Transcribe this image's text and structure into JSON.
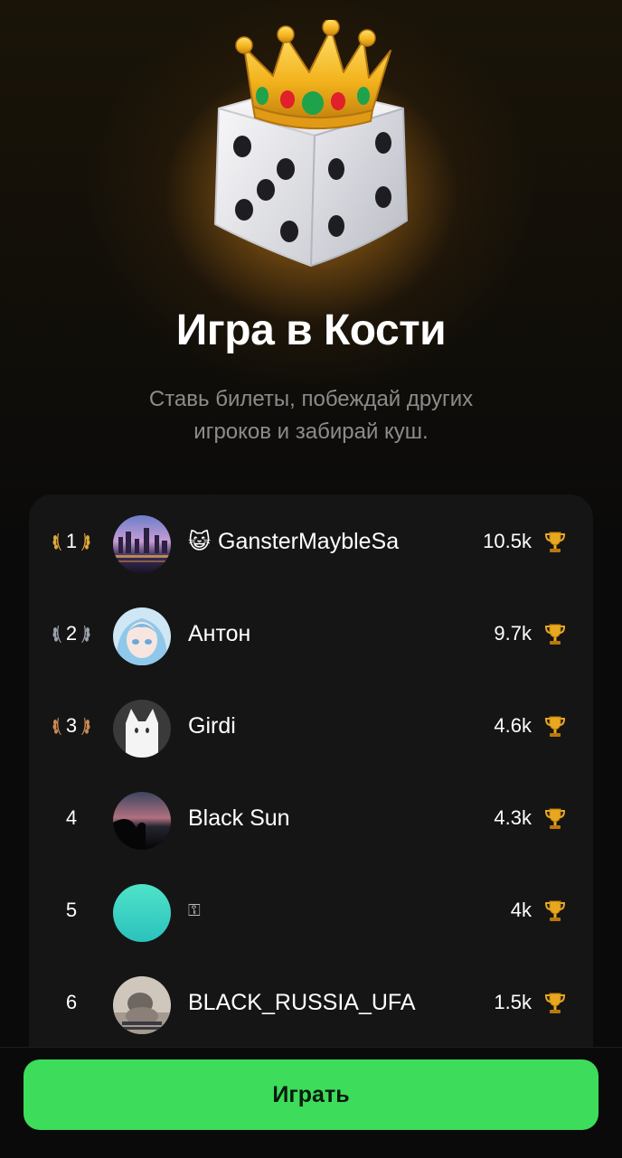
{
  "title": "Игра в Кости",
  "subtitle_line1": "Ставь билеты, побеждай других",
  "subtitle_line2": "игроков и забирай куш.",
  "leaderboard": [
    {
      "rank": "1",
      "emoji": "😺",
      "name": "GansterMaybleSa",
      "score": "10.5k",
      "laurel_color": "#e0a93a",
      "avatar": "city-night"
    },
    {
      "rank": "2",
      "emoji": "",
      "name": "Антон",
      "score": "9.7k",
      "laurel_color": "#9aa3ad",
      "avatar": "anime-girl"
    },
    {
      "rank": "3",
      "emoji": "",
      "name": "Girdi",
      "score": "4.6k",
      "laurel_color": "#c98a52",
      "avatar": "white-cat"
    },
    {
      "rank": "4",
      "emoji": "",
      "name": "Black Sun",
      "score": "4.3k",
      "laurel_color": "",
      "avatar": "dusk-silhouette"
    },
    {
      "rank": "5",
      "emoji": "",
      "name": "⚿",
      "score": "4k",
      "laurel_color": "",
      "avatar": "teal-gradient"
    },
    {
      "rank": "6",
      "emoji": "",
      "name": "BLACK_RUSSIA_UFA",
      "score": "1.5k",
      "laurel_color": "",
      "avatar": "cat-photo"
    }
  ],
  "score_icon": "trophy-icon",
  "play_button": "Играть",
  "colors": {
    "accent": "#3ddc5a",
    "gold": "#e0a93a",
    "silver": "#9aa3ad",
    "bronze": "#c98a52"
  }
}
